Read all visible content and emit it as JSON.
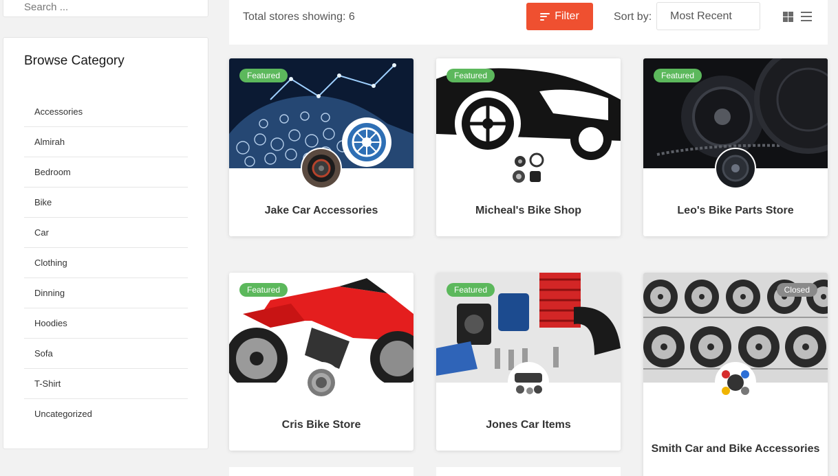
{
  "sidebar": {
    "search_placeholder": "Search ...",
    "category_title": "Browse Category",
    "categories": [
      {
        "label": "Accessories"
      },
      {
        "label": "Almirah"
      },
      {
        "label": "Bedroom"
      },
      {
        "label": "Bike"
      },
      {
        "label": "Car"
      },
      {
        "label": "Clothing"
      },
      {
        "label": "Dinning"
      },
      {
        "label": "Hoodies"
      },
      {
        "label": "Sofa"
      },
      {
        "label": "T-Shirt"
      },
      {
        "label": "Uncategorized"
      }
    ]
  },
  "toolbar": {
    "total_text": "Total stores showing: 6",
    "filter_label": "Filter",
    "sort_label": "Sort by:",
    "sort_value": "Most Recent"
  },
  "stores": [
    {
      "name": "Jake Car Accessories",
      "badge": "Featured"
    },
    {
      "name": "Micheal's Bike Shop",
      "badge": "Featured"
    },
    {
      "name": "Leo's Bike Parts Store",
      "badge": "Featured"
    },
    {
      "name": "Cris Bike Store",
      "badge": "Featured"
    },
    {
      "name": "Jones Car Items",
      "badge": "Featured"
    },
    {
      "name": "Smith Car and Bike Accessories",
      "badge": "Closed"
    }
  ],
  "colors": {
    "accent": "#ef5030",
    "featured": "#5cb85c",
    "closed": "#8a8a8a"
  }
}
